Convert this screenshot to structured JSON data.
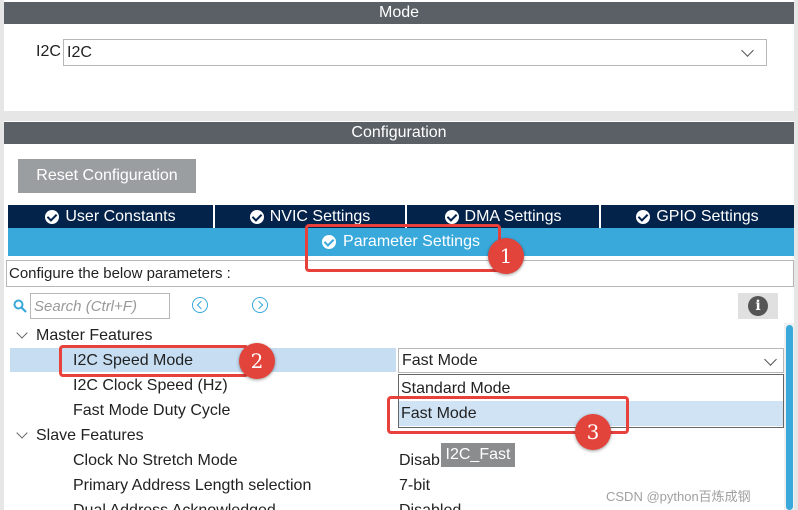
{
  "mode": {
    "title": "Mode",
    "i2c_label": "I2C",
    "i2c_value": "I2C"
  },
  "configuration": {
    "title": "Configuration",
    "reset_label": "Reset Configuration"
  },
  "tabs": [
    {
      "label": "User Constants",
      "icon": "check-circle-icon"
    },
    {
      "label": "NVIC Settings",
      "icon": "check-circle-icon"
    },
    {
      "label": "DMA Settings",
      "icon": "check-circle-icon"
    },
    {
      "label": "GPIO Settings",
      "icon": "check-circle-icon"
    }
  ],
  "active_tab": {
    "label": "Parameter Settings",
    "icon": "check-circle-icon"
  },
  "configure_text": "Configure the below parameters :",
  "search": {
    "placeholder": "Search (Ctrl+F)"
  },
  "tree": {
    "master_group": "Master Features",
    "master_items": [
      {
        "label": "I2C Speed Mode",
        "value": "Fast Mode"
      },
      {
        "label": "I2C Clock Speed (Hz)",
        "value": ""
      },
      {
        "label": "Fast Mode Duty Cycle",
        "value": ""
      }
    ],
    "slave_group": "Slave Features",
    "slave_items": [
      {
        "label": "Clock No Stretch Mode",
        "value": "Disab"
      },
      {
        "label": "Primary Address Length selection",
        "value": "7-bit"
      },
      {
        "label": "Dual Address Acknowledged",
        "value": "Disabled"
      }
    ]
  },
  "dropdown": {
    "options": [
      "Standard Mode",
      "Fast Mode"
    ],
    "selected": "Fast Mode"
  },
  "tooltip": "I2C_Fast",
  "annotations": [
    "1",
    "2",
    "3"
  ],
  "watermark": "CSDN @python百炼成钢",
  "colors": {
    "header_gray": "#5a6066",
    "tab_navy": "#03234b",
    "active_blue": "#39a9db",
    "selection_blue": "#c6ddf2",
    "annotation_red": "#e2433a"
  }
}
